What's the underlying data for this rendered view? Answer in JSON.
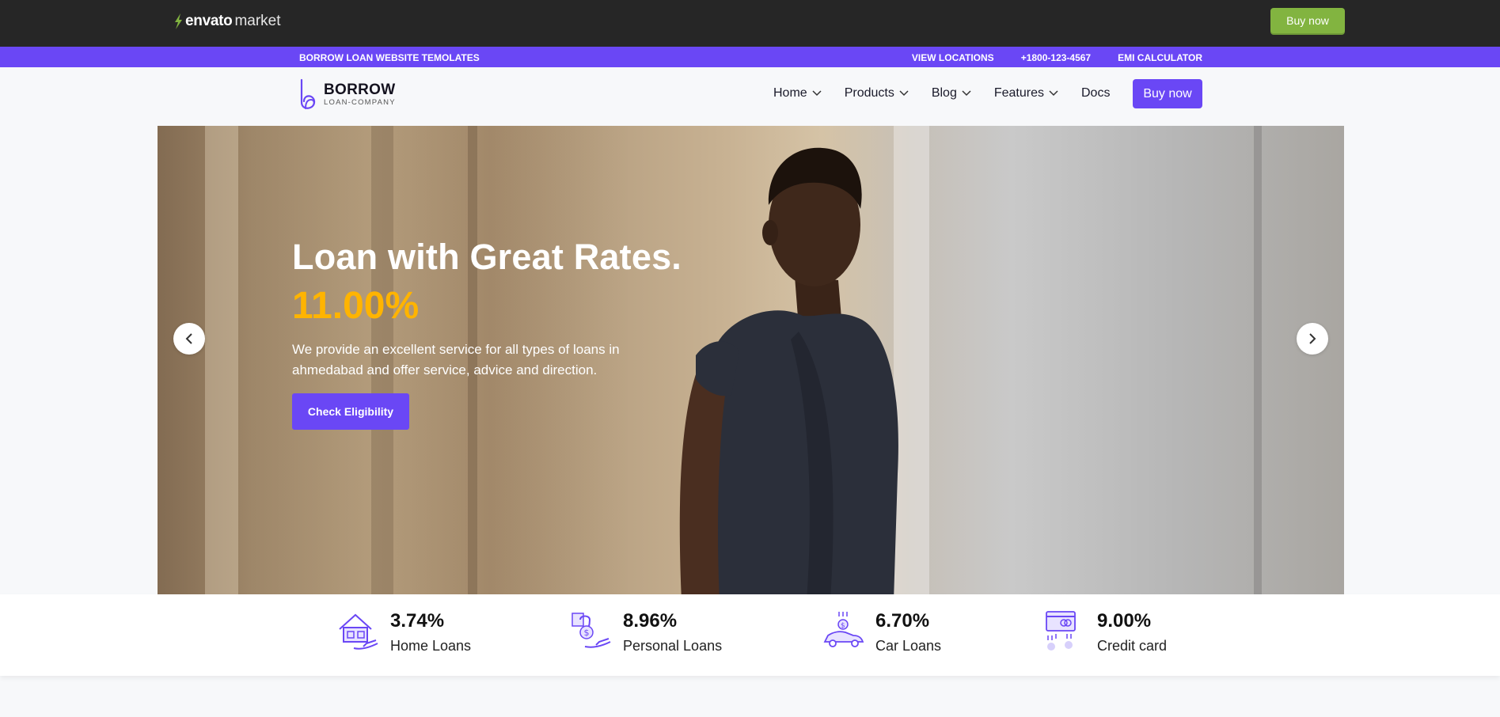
{
  "envato": {
    "brand": "envato",
    "market": "market",
    "buy_label": "Buy now",
    "accent": "#82b440"
  },
  "info_bar": {
    "site_title": "BORROW LOAN WEBSITE TEMOLATES",
    "links": [
      "VIEW LOCATIONS",
      "+1800-123-4567",
      "EMI CALCULATOR"
    ],
    "color": "#6a47f5"
  },
  "header": {
    "logo_name": "BORROW",
    "logo_sub": "LOAN-COMPANY",
    "nav": [
      {
        "label": "Home",
        "icon": "chevron-down-icon"
      },
      {
        "label": "Products",
        "icon": "chevron-down-icon"
      },
      {
        "label": "Blog",
        "icon": "chevron-down-icon"
      },
      {
        "label": "Features",
        "icon": "chevron-down-icon"
      },
      {
        "label": "Docs"
      }
    ],
    "buy_label": "Buy now"
  },
  "hero": {
    "title": "Loan with Great Rates.",
    "rate": "11.00%",
    "description": "We provide an excellent service for all types of loans in ahmedabad and offer service, advice and direction.",
    "cta_label": "Check Eligibility",
    "rate_color": "#ffb400",
    "prev_icon": "chevron-left-icon",
    "next_icon": "chevron-right-icon"
  },
  "rates": [
    {
      "value": "3.74%",
      "label": "Home Loans",
      "icon": "home-loan-icon"
    },
    {
      "value": "8.96%",
      "label": "Personal Loans",
      "icon": "personal-loan-icon"
    },
    {
      "value": "6.70%",
      "label": "Car Loans",
      "icon": "car-loan-icon"
    },
    {
      "value": "9.00%",
      "label": "Credit card",
      "icon": "credit-card-icon"
    }
  ]
}
